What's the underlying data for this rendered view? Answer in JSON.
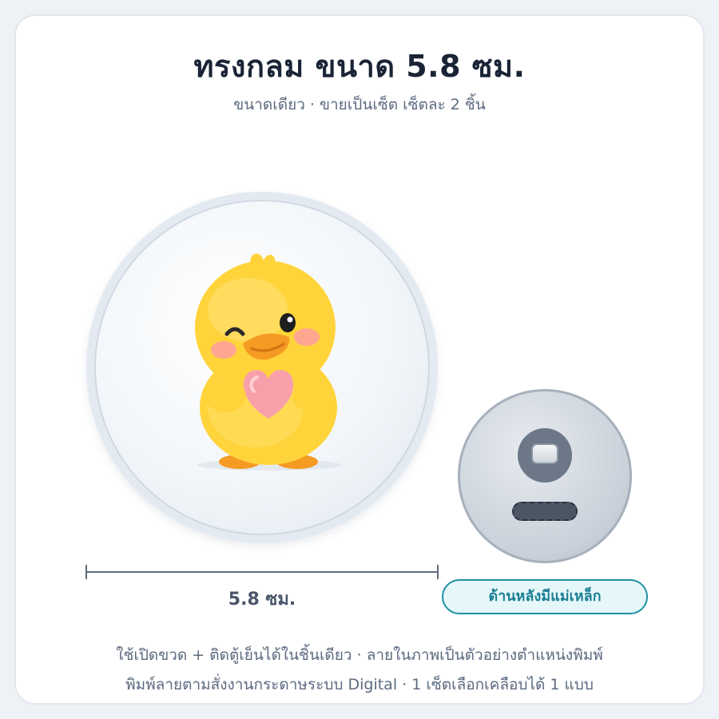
{
  "header": {
    "title": "ทรงกลม ขนาด 5.8 ซม.",
    "subtitle": "ขนาดเดียว · ขายเป็นเซ็ต เซ็ตละ 2 ชิ้น"
  },
  "product": {
    "front_illustration": "winking-yellow-duckling-holding-pink-heart",
    "back_icon": "magnet-icon"
  },
  "dimension": {
    "label": "5.8 ซม."
  },
  "back_label": "ด้านหลังมีแม่เหล็ก",
  "footer": {
    "line1": "ใช้เปิดขวด + ติดตู้เย็นได้ในชิ้นเดียว · ลายในภาพเป็นตัวอย่างตำแหน่งพิมพ์",
    "line2": "พิมพ์ลายตามสั่งงานกระดาษระบบ Digital · 1 เซ็ตเลือกเคลือบได้ 1 แบบ"
  },
  "colors": {
    "title": "#1a2436",
    "muted_text": "#5c6a80",
    "accent_teal": "#1f8fa4",
    "duck_yellow": "#ffd43b",
    "heart_pink": "#f8a0aa"
  }
}
